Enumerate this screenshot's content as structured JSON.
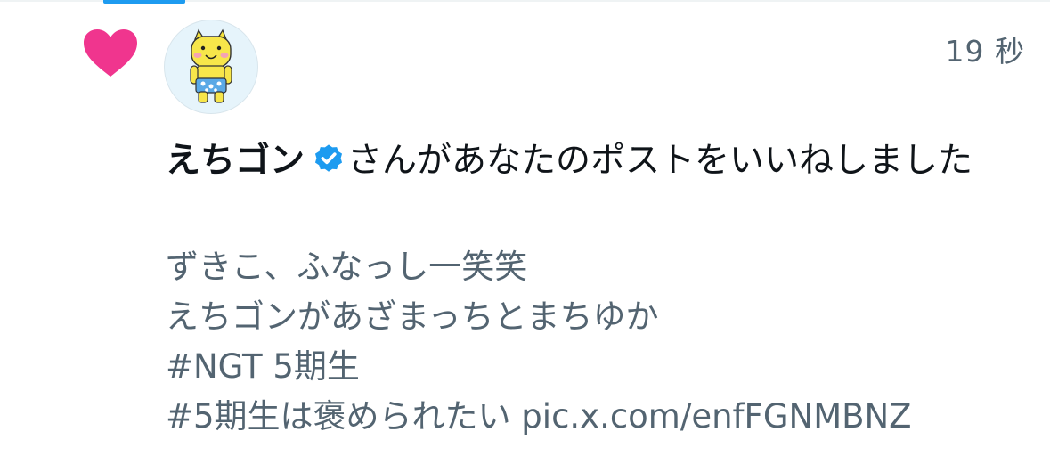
{
  "notification": {
    "type_icon": "heart-icon",
    "accent_color": "#f91880",
    "timestamp": "19 秒",
    "user": {
      "name": "えちゴン",
      "verified": true,
      "verified_icon": "verified-badge-icon",
      "verified_color": "#1d9bf0",
      "avatar_icon": "yellow-mascot-avatar"
    },
    "action_text": "さんがあなたのポストをいいねしました",
    "post_lines": [
      "ずきこ、ふなっし一笑笑",
      "えちゴンがあざまっちとまちゆか",
      "#NGT 5期生",
      "#5期生は褒められたい pic.x.com/enfFGNMBNZ"
    ]
  }
}
